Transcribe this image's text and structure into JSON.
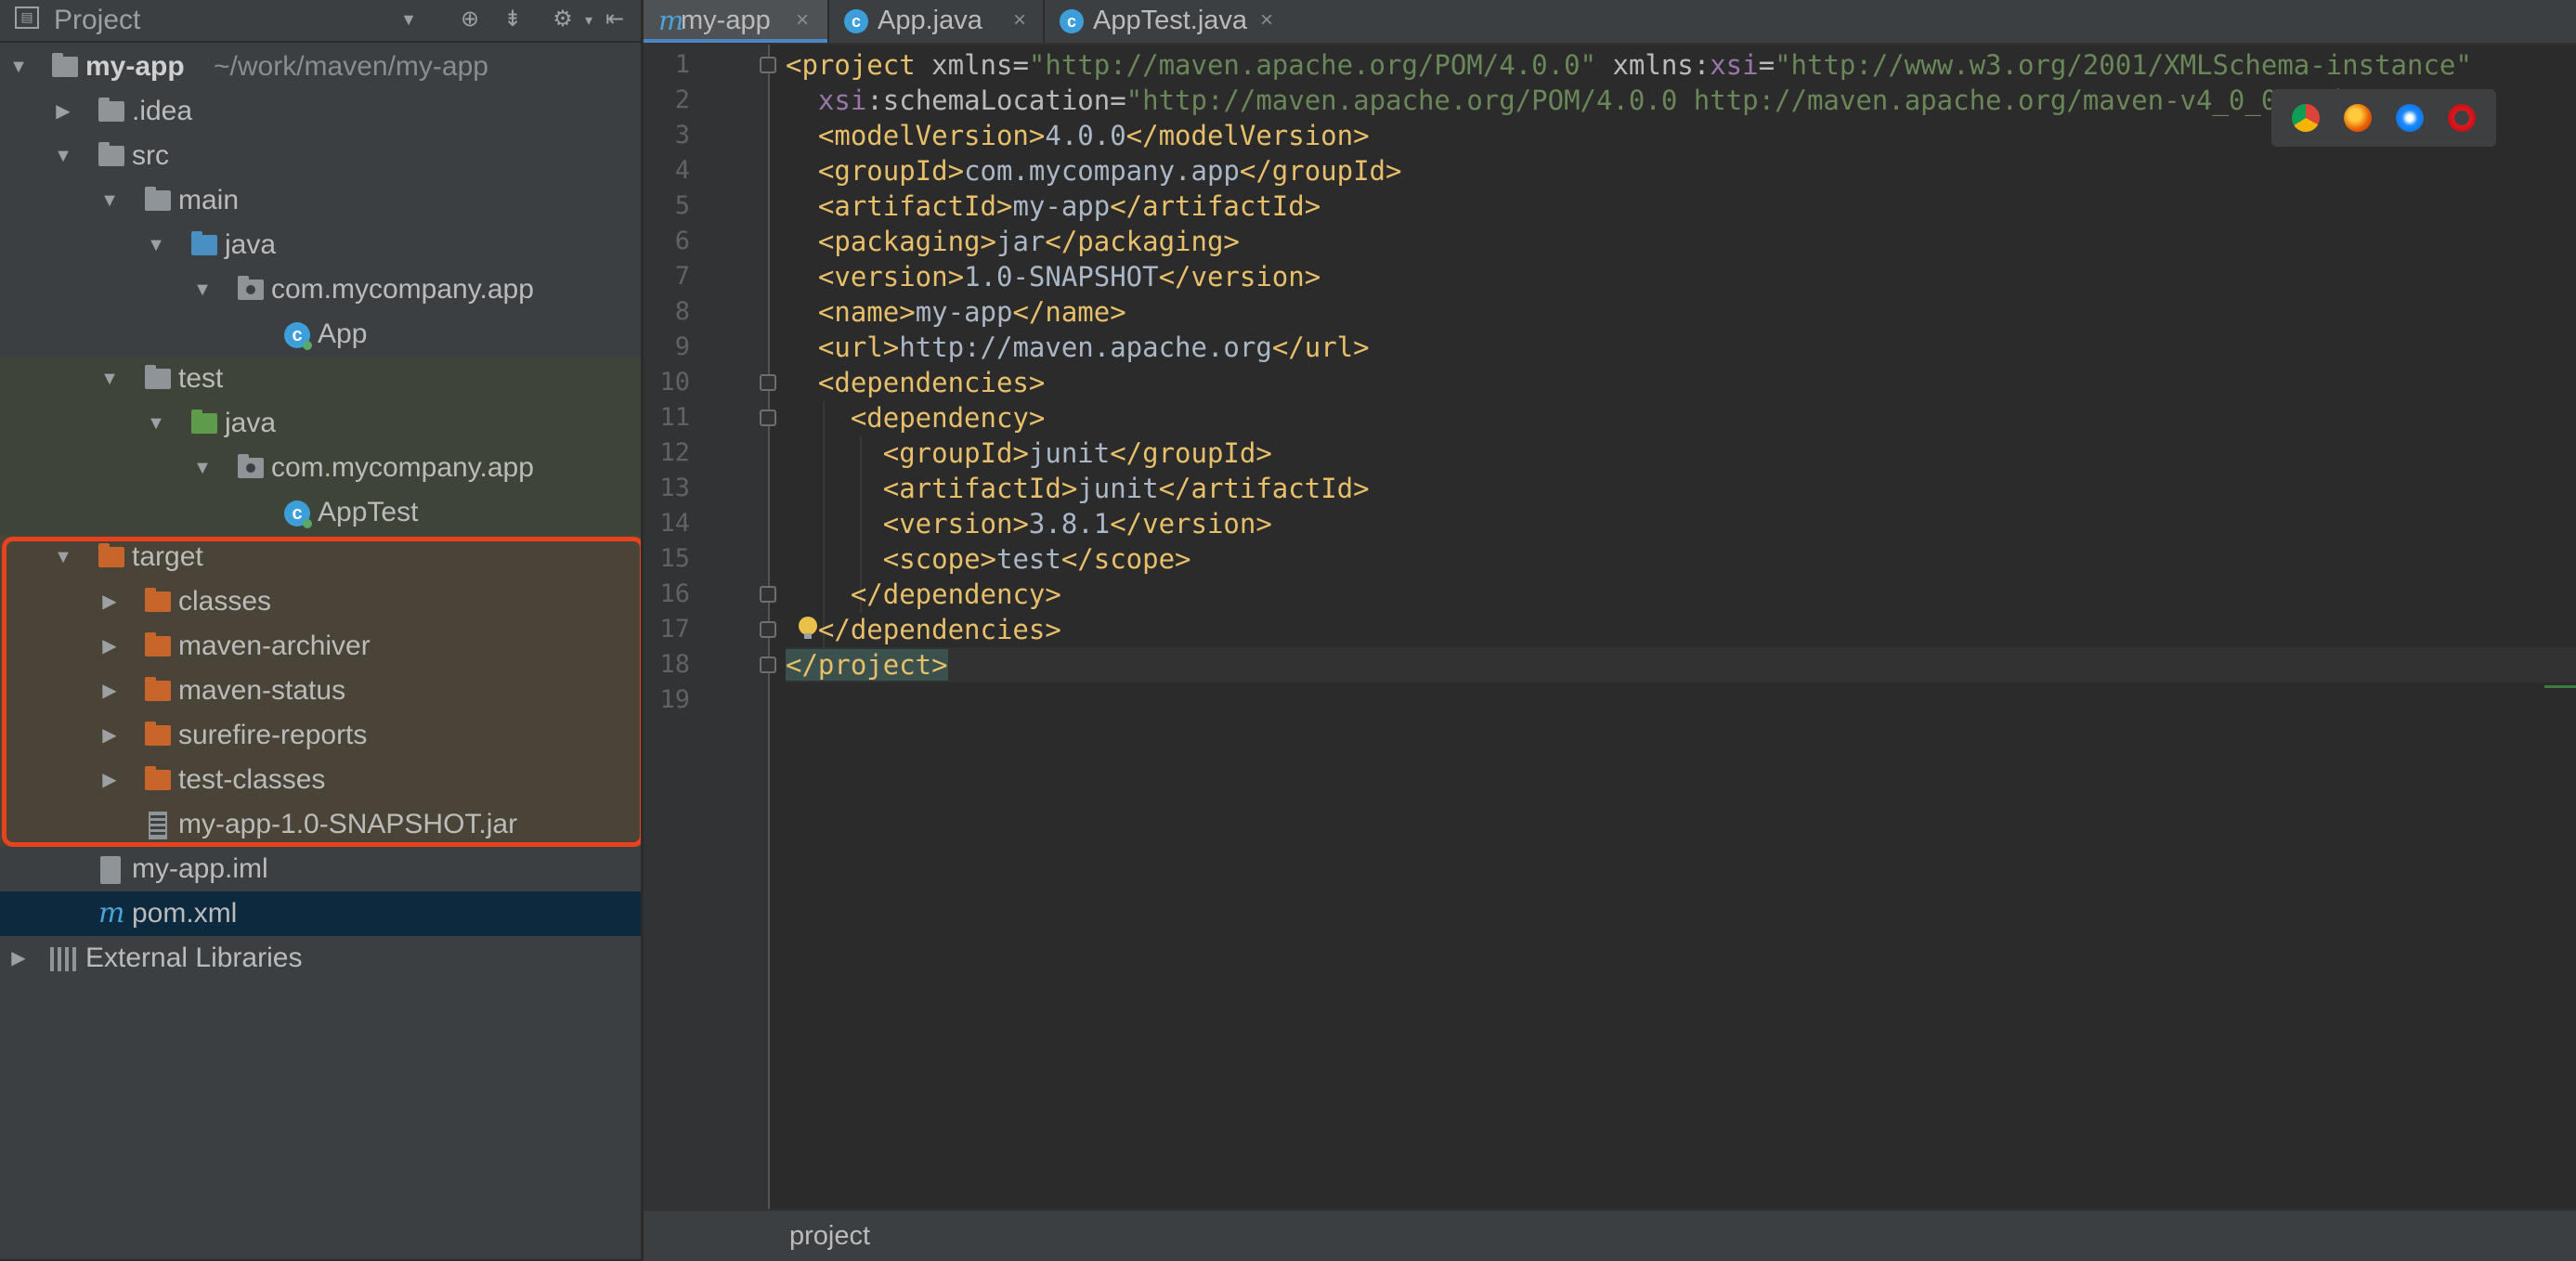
{
  "sidebar": {
    "title": "Project",
    "header_icons": [
      "dropdown-icon",
      "locate-icon",
      "collapse-all-icon",
      "gear-icon",
      "hide-icon"
    ],
    "root": {
      "name": "my-app",
      "path": "~/work/maven/my-app"
    },
    "items": [
      {
        "label": ".idea"
      },
      {
        "label": "src"
      },
      {
        "label": "main"
      },
      {
        "label": "java"
      },
      {
        "label": "com.mycompany.app"
      },
      {
        "label": "App"
      },
      {
        "label": "test"
      },
      {
        "label": "java"
      },
      {
        "label": "com.mycompany.app"
      },
      {
        "label": "AppTest"
      },
      {
        "label": "target"
      },
      {
        "label": "classes"
      },
      {
        "label": "maven-archiver"
      },
      {
        "label": "maven-status"
      },
      {
        "label": "surefire-reports"
      },
      {
        "label": "test-classes"
      },
      {
        "label": "my-app-1.0-SNAPSHOT.jar"
      },
      {
        "label": "my-app.iml"
      },
      {
        "label": "pom.xml"
      },
      {
        "label": "External Libraries"
      }
    ]
  },
  "tabs": [
    {
      "label": "my-app",
      "icon": "maven-icon",
      "close": "×"
    },
    {
      "label": "App.java",
      "icon": "class-icon",
      "close": "×"
    },
    {
      "label": "AppTest.java",
      "icon": "class-icon",
      "close": "×"
    }
  ],
  "editor": {
    "line_numbers": [
      "1",
      "2",
      "3",
      "4",
      "5",
      "6",
      "7",
      "8",
      "9",
      "10",
      "11",
      "12",
      "13",
      "14",
      "15",
      "16",
      "17",
      "18",
      "19"
    ],
    "tokens": {
      "project_open": "<project",
      "xmlns_attr": " xmlns=",
      "xmlns_val": "\"http://maven.apache.org/POM/4.0.0\"",
      "xmlns_prefix": " xmlns:",
      "xsi": "xsi",
      "xsi_eq": "=",
      "xsi_val": "\"http://www.w3.org/2001/XMLSchema-instance\"",
      "schema_prefix": "xsi",
      "schema_attr": ":schemaLocation=",
      "schema_val": "\"http://maven.apache.org/POM/4.0.0 http://maven.apache.org/maven-v4_0_0.xsd\"",
      "schema_close": ">",
      "modelVersion_open": "<modelVersion>",
      "modelVersion_text": "4.0.0",
      "modelVersion_close": "</modelVersion>",
      "groupId_open": "<groupId>",
      "groupId_text": "com.mycompany.app",
      "groupId_close": "</groupId>",
      "artifactId_open": "<artifactId>",
      "artifactId_text": "my-app",
      "artifactId_close": "</artifactId>",
      "packaging_open": "<packaging>",
      "packaging_text": "jar",
      "packaging_close": "</packaging>",
      "version_open": "<version>",
      "version_text": "1.0-SNAPSHOT",
      "version_close": "</version>",
      "name_open": "<name>",
      "name_text": "my-app",
      "name_close": "</name>",
      "url_open": "<url>",
      "url_text": "http://maven.apache.org",
      "url_close": "</url>",
      "dependencies_open": "<dependencies>",
      "dependency_open": "<dependency>",
      "dep_groupId_text": "junit",
      "dep_artifactId_text": "junit",
      "dep_version_text": "3.8.1",
      "scope_open": "<scope>",
      "scope_text": "test",
      "scope_close": "</scope>",
      "dependency_close": "</dependency>",
      "dependencies_close": "</dependencies>",
      "project_close": "</project>"
    },
    "browser_icons": [
      "chrome-icon",
      "firefox-icon",
      "safari-icon",
      "opera-icon"
    ]
  },
  "breadcrumb": {
    "label": "project"
  },
  "colors": {
    "highlight_border": "#e8431f",
    "tag": "#e8bf6a",
    "value": "#6a8759",
    "selection": "#0d293e"
  }
}
